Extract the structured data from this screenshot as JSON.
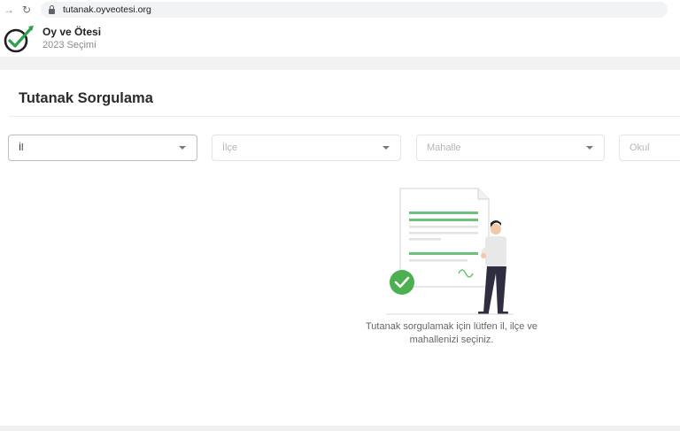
{
  "browser": {
    "url": "tutanak.oyveotesi.org",
    "back_icon": "→",
    "reload_icon": "↻"
  },
  "brand": {
    "name": "Oy ve Ötesi",
    "subtitle": "2023 Seçimi",
    "accent_color": "#2e9e4f"
  },
  "page": {
    "title": "Tutanak Sorgulama"
  },
  "filters": {
    "il": "İl",
    "ilce": "İlçe",
    "mahalle": "Mahalle",
    "okul": "Okul"
  },
  "empty_state": {
    "message": "Tutanak sorgulamak için lütfen il, ilçe ve mahallenizi seçiniz.",
    "check_color": "#4caf50",
    "line_color": "#6cc27c"
  }
}
